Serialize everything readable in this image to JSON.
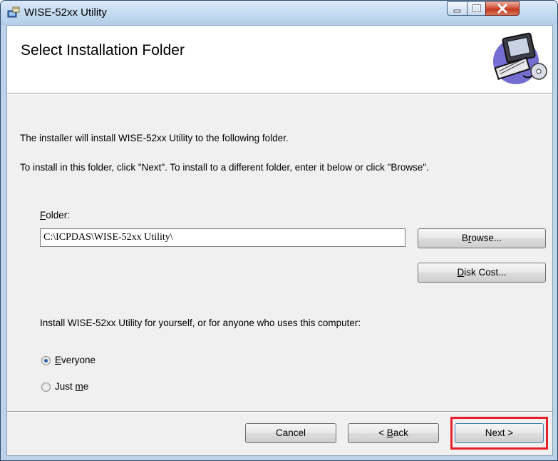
{
  "window": {
    "title": "WISE-52xx Utility",
    "app_icon": "installer-icon"
  },
  "banner": {
    "title": "Select Installation Folder",
    "art": "computer-cd-icon"
  },
  "body": {
    "line1": "The installer will install WISE-52xx Utility to the following folder.",
    "line2": "To install in this folder, click \"Next\". To install to a different folder, enter it below or click \"Browse\"."
  },
  "folder": {
    "label_pre": "",
    "label_ul": "F",
    "label_post": "older:",
    "value": "C:\\ICPDAS\\WISE-52xx Utility\\"
  },
  "buttons": {
    "browse_pre": "B",
    "browse_ul": "r",
    "browse_post": "owse...",
    "diskcost_pre": "",
    "diskcost_ul": "D",
    "diskcost_post": "isk Cost...",
    "cancel": "Cancel",
    "back_pre": "< ",
    "back_ul": "B",
    "back_post": "ack",
    "next": "Next >"
  },
  "install_for": {
    "prompt": "Install WISE-52xx Utility for yourself, or for anyone who uses this computer:",
    "options": [
      {
        "pre": "",
        "ul": "E",
        "post": "veryone",
        "selected": true
      },
      {
        "pre": "Just ",
        "ul": "m",
        "post": "e",
        "selected": false
      }
    ]
  },
  "colors": {
    "highlight": "#e8202a",
    "radio_dot": "#2a5fa8"
  }
}
